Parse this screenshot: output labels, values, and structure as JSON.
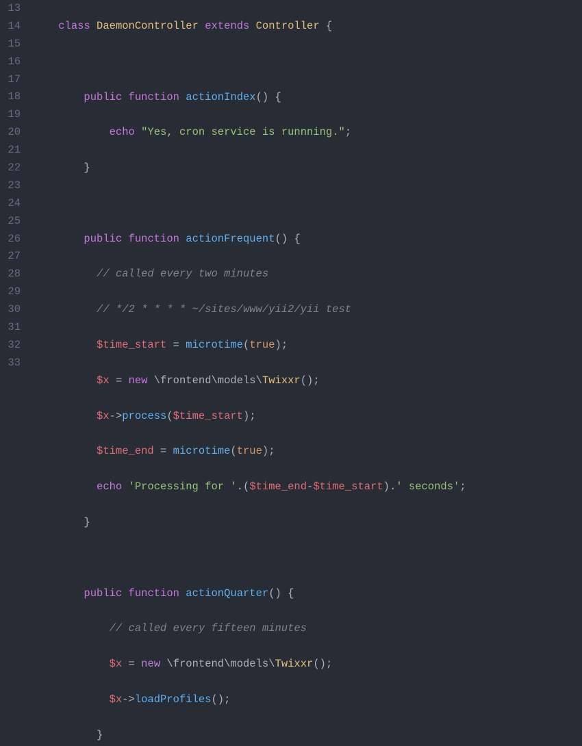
{
  "lines": [
    {
      "num": "13"
    },
    {
      "num": "14"
    },
    {
      "num": "15"
    },
    {
      "num": "16"
    },
    {
      "num": "17"
    },
    {
      "num": "18"
    },
    {
      "num": "19"
    },
    {
      "num": "20"
    },
    {
      "num": "21"
    },
    {
      "num": "22"
    },
    {
      "num": "23"
    },
    {
      "num": "24"
    },
    {
      "num": "25"
    },
    {
      "num": "26"
    },
    {
      "num": "27"
    },
    {
      "num": "28"
    },
    {
      "num": "29"
    },
    {
      "num": "30"
    },
    {
      "num": "31"
    },
    {
      "num": "32"
    },
    {
      "num": "33"
    }
  ],
  "t": {
    "class": "class",
    "extends": "extends",
    "public": "public",
    "function": "function",
    "echo": "echo",
    "new": "new",
    "true": "true",
    "DaemonController": "DaemonController",
    "Controller": "Controller",
    "actionIndex": "actionIndex",
    "actionFrequent": "actionFrequent",
    "actionQuarter": "actionQuarter",
    "microtime": "microtime",
    "process": "process",
    "loadProfiles": "loadProfiles",
    "yes_str": "\"Yes, cron service is runnning.\"",
    "cmt1": "// called every two minutes",
    "cmt2": "// */2 * * * * ~/sites/www/yii2/yii test",
    "cmt3": "// called every fifteen minutes",
    "time_start": "$time_start",
    "time_end": "$time_end",
    "x": "$x",
    "ns_prefix": "\\frontend\\models\\",
    "Twixxr": "Twixxr",
    "proc_str1": "'Processing for '",
    "proc_str2": "' seconds'"
  }
}
